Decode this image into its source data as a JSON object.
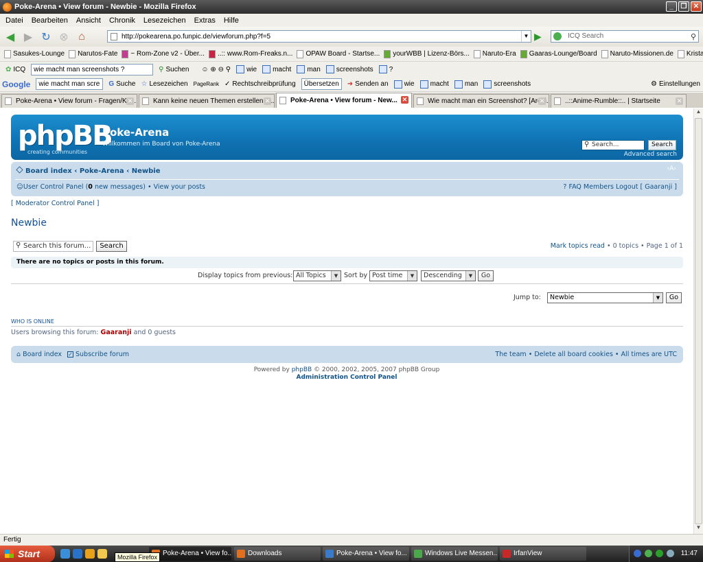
{
  "window": {
    "title": "Poke-Arena • View forum - Newbie - Mozilla Firefox"
  },
  "menu": [
    "Datei",
    "Bearbeiten",
    "Ansicht",
    "Chronik",
    "Lesezeichen",
    "Extras",
    "Hilfe"
  ],
  "address": {
    "url": "http://pokearena.po.funpic.de/viewforum.php?f=5",
    "search_placeholder": "ICQ Search"
  },
  "bookmarks": [
    "Sasukes-Lounge",
    "Narutos-Fate",
    "~ Rom-Zone v2 - Über...",
    "..:: www.Rom-Freaks.n...",
    "OPAW Board - Startse...",
    "yourWBB | Lizenz-Börs...",
    "Naruto-Era",
    "Gaaras-Lounge/Board",
    "Naruto-Missionen.de",
    "Kristall Lobby | Startseite"
  ],
  "icq_bar": {
    "label": "ICQ",
    "query": "wie macht man screenshots ?",
    "search": "Suchen",
    "words": [
      "wie",
      "macht",
      "man",
      "screenshots",
      "?"
    ]
  },
  "google_bar": {
    "logo": "Google",
    "query": "wie macht man scre",
    "items": [
      "Suche",
      "Lesezeichen",
      "PageRank",
      "Rechtschreibprüfung",
      "Übersetzen",
      "Senden an",
      "wie",
      "macht",
      "man",
      "screenshots"
    ],
    "settings": "Einstellungen"
  },
  "tabs": [
    {
      "label": "Poke-Arena • View forum - Fragen/Kriti...",
      "active": false
    },
    {
      "label": "Kann keine neuen Themen erstellen ......",
      "active": false
    },
    {
      "label": "Poke-Arena • View forum - New...",
      "active": true
    },
    {
      "label": "Wie macht man ein Screenshot? [Archi...",
      "active": false
    },
    {
      "label": "..::Anime-Rumble::.. | Startseite",
      "active": false
    }
  ],
  "forum": {
    "logo": "phpBB",
    "logo_sub": "creating   communities",
    "site_title": "Poke-Arena",
    "site_desc": "Willkommen im Board von Poke-Arena",
    "search_placeholder": "Search...",
    "search_button": "Search",
    "advanced_search": "Advanced search",
    "breadcrumbs": "Board index ‹ Poke-Arena ‹ Newbie",
    "fontsize": "‹A›",
    "ucp_label": "User Control Panel (",
    "ucp_count": "0",
    "ucp_rest": " new messages) • View your posts",
    "user_links": "FAQ   Members   Logout [ Gaaranji ]",
    "mcp": "[ Moderator Control Panel ]",
    "forum_title": "Newbie",
    "forum_search_placeholder": "Search this forum...",
    "forum_search_button": "Search",
    "mark_read": "Mark topics read",
    "pagination": " • 0 topics • Page 1 of 1",
    "no_topics": "There are no topics or posts in this forum.",
    "display_label": "Display topics from previous:",
    "display_value": "All Topics",
    "sort_label": "Sort by",
    "sort_value": "Post time",
    "order_value": "Descending",
    "go": "Go",
    "jump_label": "Jump to:",
    "jump_value": "Newbie",
    "who_title": "Who is online",
    "who_text_pre": "Users browsing this forum: ",
    "who_user": "Gaaranji",
    "who_text_post": " and 0 guests",
    "foot_left_1": "Board index",
    "foot_left_2": "Subscribe forum",
    "foot_right": "The team • Delete all board cookies • All times are UTC",
    "powered_pre": "Powered by ",
    "powered_link": "phpBB",
    "powered_post": " © 2000, 2002, 2005, 2007 phpBB Group",
    "acp": "Administration Control Panel"
  },
  "status": "Fertig",
  "taskbar": {
    "start": "Start",
    "tooltip": "Mozilla Firefox",
    "tasks": [
      "Poke-Arena • View fo...",
      "Downloads",
      "Poke-Arena • View fo...",
      "Windows Live Messen...",
      "IrfanView"
    ],
    "clock": "11:47"
  }
}
